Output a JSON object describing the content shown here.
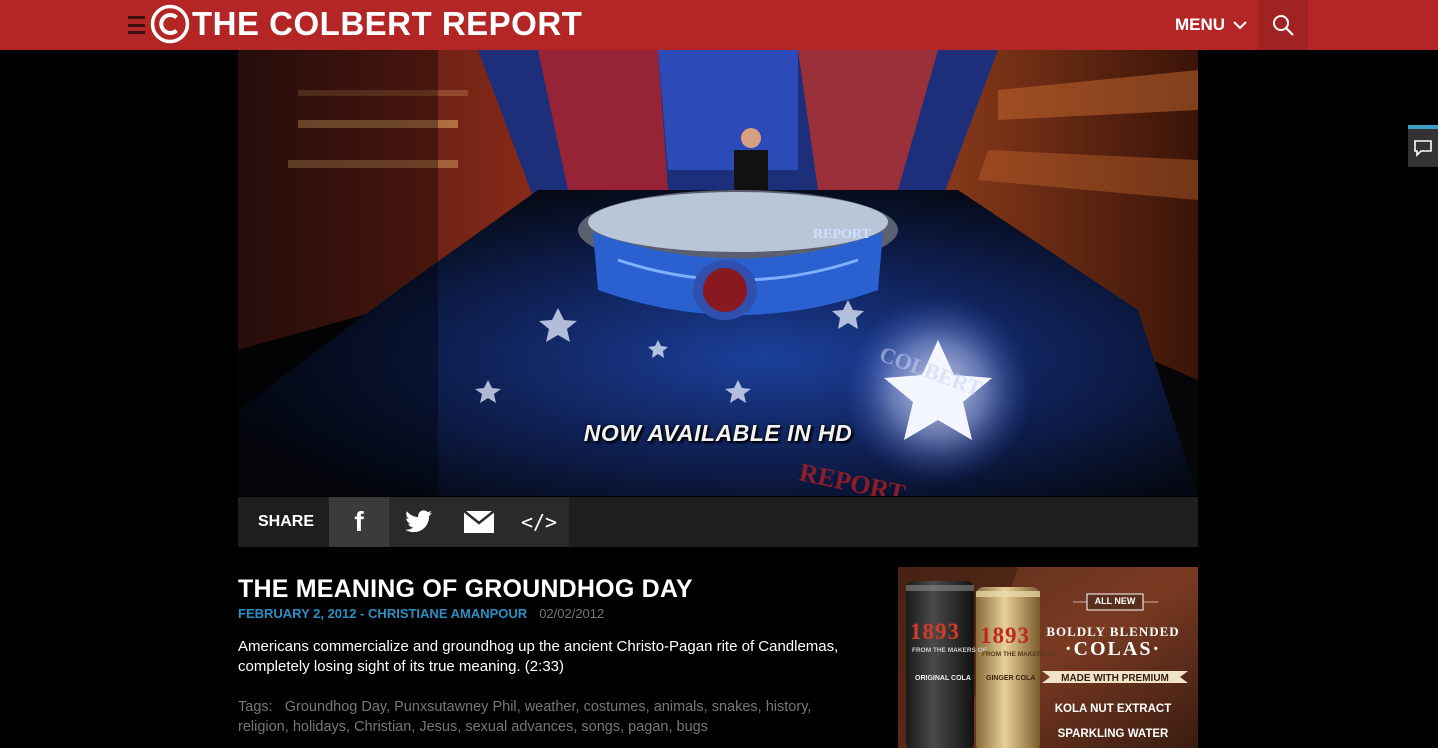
{
  "header": {
    "logo_text": "THE COLBERT REPORT",
    "logo_symbol": "C",
    "menu_label": "MENU",
    "icons": [
      "hamburger-icon",
      "chevron-down-icon",
      "search-icon"
    ]
  },
  "video": {
    "caption": "NOW AVAILABLE IN HD",
    "desk_text": "REPORT",
    "floor_text_1": "COLBERT",
    "floor_text_2": "REPORT"
  },
  "share": {
    "label": "SHARE",
    "facebook_glyph": "f",
    "embed_glyph": "</>"
  },
  "article": {
    "title": "THE MEANING OF GROUNDHOG DAY",
    "episode_link": "FEBRUARY 2, 2012 - CHRISTIANE AMANPOUR",
    "air_date": "02/02/2012",
    "description": "Americans commercialize and groundhog up the ancient Christo-Pagan rite of Candlemas, completely losing sight of its true meaning. (2:33)",
    "tags_label": "Tags:",
    "tags": [
      "Groundhog Day",
      "Punxsutawney Phil",
      "weather",
      "costumes",
      "animals",
      "snakes",
      "history",
      "religion",
      "holidays",
      "Christian",
      "Jesus",
      "sexual advances",
      "songs",
      "pagan",
      "bugs"
    ]
  },
  "ad": {
    "can1_year": "1893",
    "can1_sub": "FROM THE MAKERS OF",
    "can1_label": "ORIGINAL COLA",
    "can2_year": "1893",
    "can2_sub": "FROM THE MAKERS OF",
    "can2_label": "GINGER COLA",
    "badge": "ALL NEW",
    "headline_1": "BOLDLY BLENDED",
    "headline_2": "·COLAS·",
    "banner": "MADE WITH PREMIUM",
    "line_1": "KOLA NUT EXTRACT",
    "line_2": "SPARKLING WATER"
  },
  "colors": {
    "brand_red": "#b42626",
    "link_blue": "#2b8fc4",
    "muted_text": "#777777",
    "share_bar": "#1e1e1e"
  }
}
